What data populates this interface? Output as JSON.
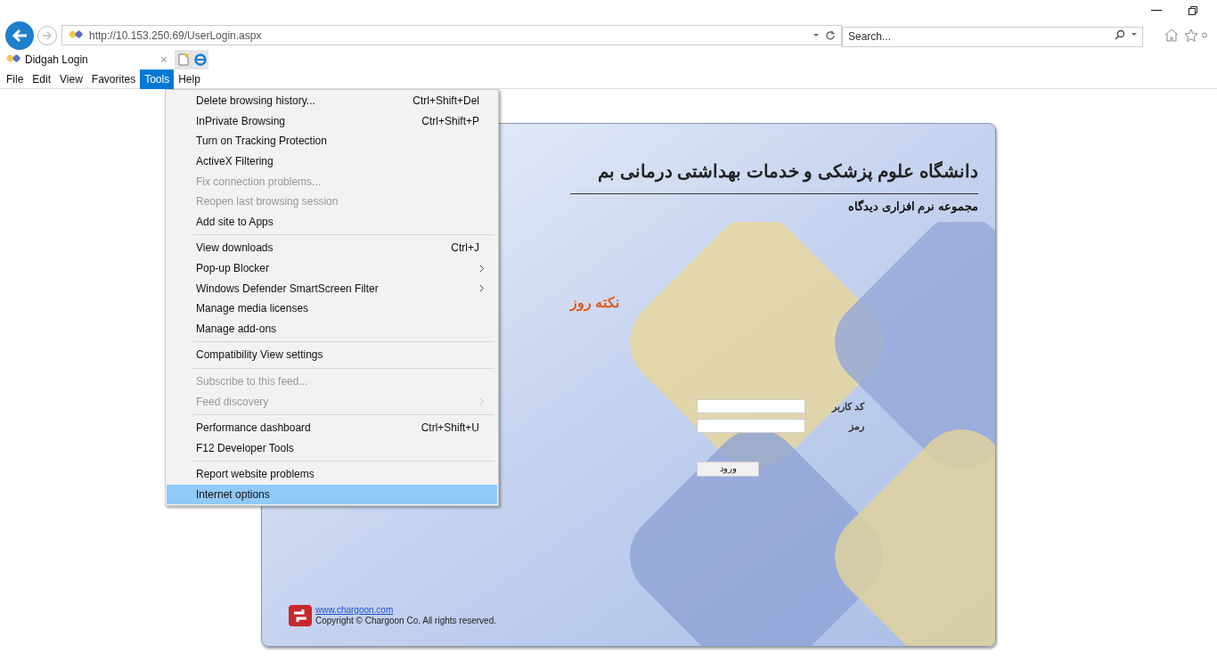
{
  "address_bar": {
    "url": "http://10.153.250.69/UserLogin.aspx"
  },
  "search": {
    "placeholder": "Search..."
  },
  "tab": {
    "title": "Didgah Login",
    "close": "×"
  },
  "menu_bar": [
    {
      "label": "File",
      "selected": false
    },
    {
      "label": "Edit",
      "selected": false
    },
    {
      "label": "View",
      "selected": false
    },
    {
      "label": "Favorites",
      "selected": false
    },
    {
      "label": "Tools",
      "selected": true
    },
    {
      "label": "Help",
      "selected": false
    }
  ],
  "tools_menu": {
    "groups": [
      [
        {
          "label": "Delete browsing history...",
          "shortcut": "Ctrl+Shift+Del",
          "submenu": false,
          "disabled": false,
          "selected": false
        },
        {
          "label": "InPrivate Browsing",
          "shortcut": "Ctrl+Shift+P",
          "submenu": false,
          "disabled": false,
          "selected": false
        },
        {
          "label": "Turn on Tracking Protection",
          "submenu": false,
          "disabled": false,
          "selected": false
        },
        {
          "label": "ActiveX Filtering",
          "submenu": false,
          "disabled": false,
          "selected": false
        },
        {
          "label": "Fix connection problems...",
          "submenu": false,
          "disabled": true,
          "selected": false
        },
        {
          "label": "Reopen last browsing session",
          "submenu": false,
          "disabled": true,
          "selected": false
        },
        {
          "label": "Add site to Apps",
          "submenu": false,
          "disabled": false,
          "selected": false
        }
      ],
      [
        {
          "label": "View downloads",
          "shortcut": "Ctrl+J",
          "submenu": false,
          "disabled": false,
          "selected": false
        },
        {
          "label": "Pop-up Blocker",
          "submenu": true,
          "disabled": false,
          "selected": false
        },
        {
          "label": "Windows Defender SmartScreen Filter",
          "submenu": true,
          "disabled": false,
          "selected": false
        },
        {
          "label": "Manage media licenses",
          "submenu": false,
          "disabled": false,
          "selected": false
        },
        {
          "label": "Manage add-ons",
          "submenu": false,
          "disabled": false,
          "selected": false
        }
      ],
      [
        {
          "label": "Compatibility View settings",
          "submenu": false,
          "disabled": false,
          "selected": false
        }
      ],
      [
        {
          "label": "Subscribe to this feed...",
          "submenu": false,
          "disabled": true,
          "selected": false
        },
        {
          "label": "Feed discovery",
          "submenu": true,
          "disabled": true,
          "selected": false
        }
      ],
      [
        {
          "label": "Performance dashboard",
          "shortcut": "Ctrl+Shift+U",
          "submenu": false,
          "disabled": false,
          "selected": false
        },
        {
          "label": "F12 Developer Tools",
          "submenu": false,
          "disabled": false,
          "selected": false
        }
      ],
      [
        {
          "label": "Report website problems",
          "submenu": false,
          "disabled": false,
          "selected": false
        },
        {
          "label": "Internet options",
          "submenu": false,
          "disabled": false,
          "selected": true
        }
      ]
    ]
  },
  "login": {
    "title": "دانشگاه علوم پزشکی و خدمات بهداشتی درمانی بم",
    "subtitle": "مجموعه نرم افزاری دیدگاه",
    "tip_heading": "نکته روز",
    "fields": [
      {
        "label": "کد کاربر"
      },
      {
        "label": "رمز"
      }
    ],
    "submit": "ورود",
    "footer_link": "www.chargoon.com",
    "copyright": "Copyright © Chargoon Co. All rights reserved."
  }
}
